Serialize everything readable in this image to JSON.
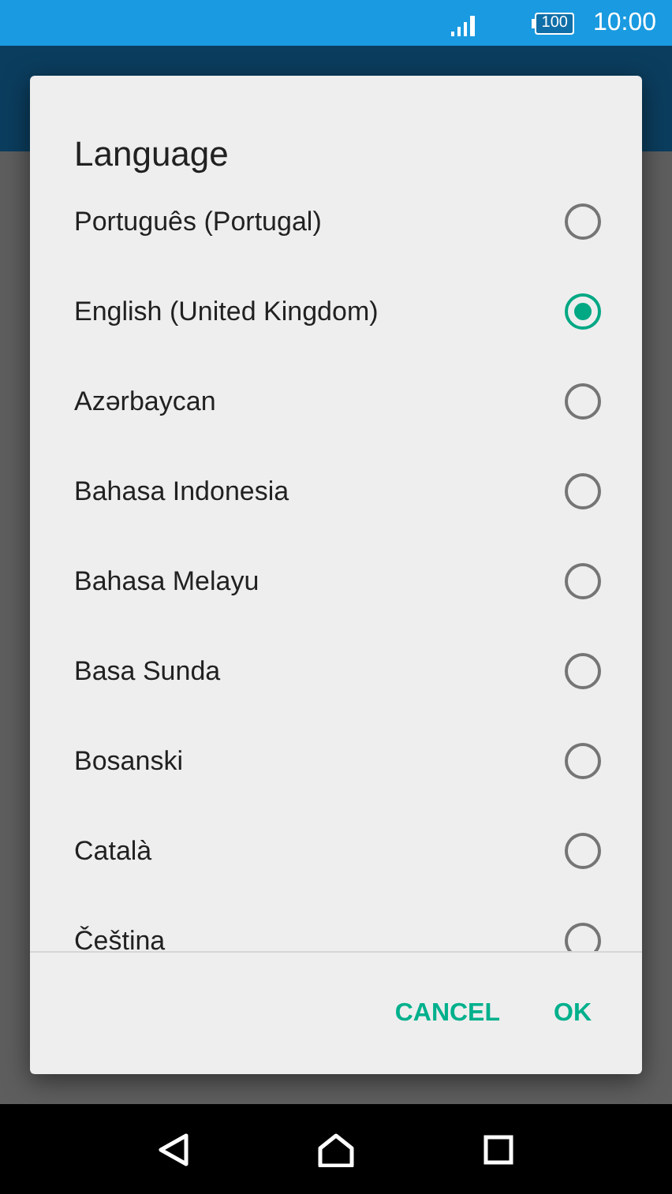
{
  "status_bar": {
    "battery": "100",
    "time": "10:00"
  },
  "dialog": {
    "title": "Language",
    "options": [
      {
        "label": "Português (Portugal)",
        "selected": false
      },
      {
        "label": "English (United Kingdom)",
        "selected": true
      },
      {
        "label": "Azərbaycan",
        "selected": false
      },
      {
        "label": "Bahasa Indonesia",
        "selected": false
      },
      {
        "label": "Bahasa Melayu",
        "selected": false
      },
      {
        "label": "Basa Sunda",
        "selected": false
      },
      {
        "label": "Bosanski",
        "selected": false
      },
      {
        "label": "Català",
        "selected": false
      },
      {
        "label": "Čeština",
        "selected": false
      }
    ],
    "buttons": [
      "CANCEL",
      "OK"
    ]
  }
}
